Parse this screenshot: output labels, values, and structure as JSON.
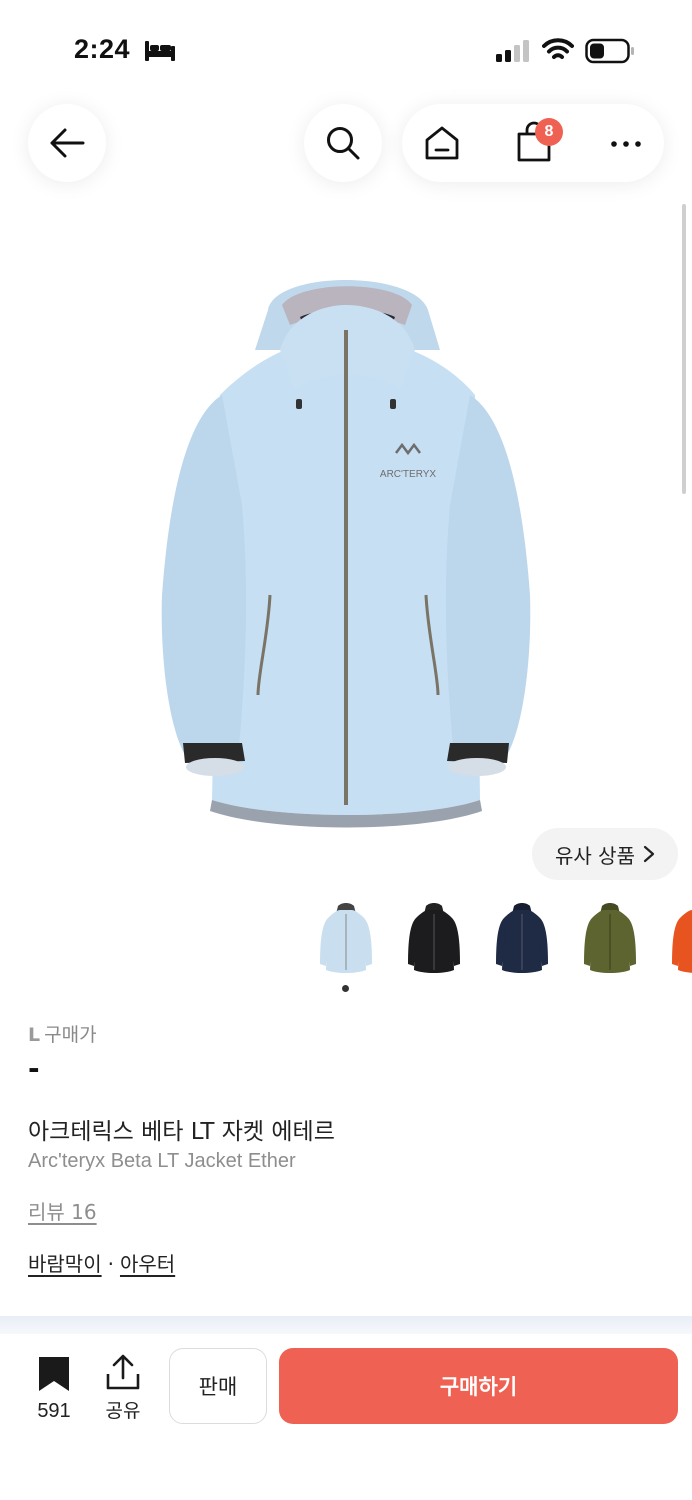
{
  "status_bar": {
    "time": "2:24"
  },
  "nav": {
    "cart_count": "8"
  },
  "product": {
    "similar_label": "유사 상품",
    "size": "L",
    "price_label": "구매가",
    "price_value": "-",
    "name_ko": "아크테릭스 베타 LT 자켓 에테르",
    "name_en": "Arc'teryx Beta LT Jacket Ether",
    "review_label": "리뷰 16",
    "category_1": "바람막이",
    "category_sep": "·",
    "category_2": "아우터",
    "brand_logo_text": "ARC'TERYX",
    "thumbnail_colors": [
      "#c9dff0",
      "#1c1c1e",
      "#1f2a44",
      "#5d6430",
      "#e8541f"
    ]
  },
  "bottom_bar": {
    "bookmark_count": "591",
    "share_label": "공유",
    "sell_label": "판매",
    "buy_label": "구매하기"
  },
  "colors": {
    "accent": "#ef6253",
    "jacket": "#c6dff3"
  }
}
